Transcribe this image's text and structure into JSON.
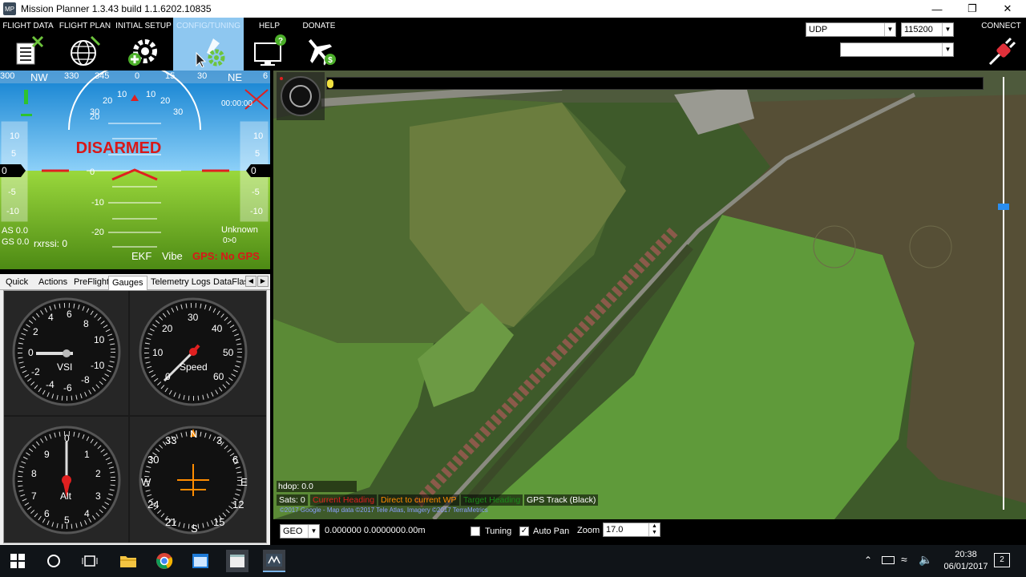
{
  "window": {
    "title": "Mission Planner 1.3.43 build 1.1.6202.10835",
    "app_icon_text": "MP"
  },
  "menu": {
    "flight_data": "FLIGHT DATA",
    "flight_plan": "FLIGHT PLAN",
    "initial_setup": "INITIAL SETUP",
    "config_tuning": "CONFIG/TUNING",
    "help": "HELP",
    "donate": "DONATE",
    "connect": "CONNECT"
  },
  "connection": {
    "port": "UDP",
    "baud": "115200",
    "profile": ""
  },
  "hud": {
    "status": "DISARMED",
    "compass_labels": [
      "300",
      "NW",
      "330",
      "345",
      "0",
      "15",
      "30",
      "NE",
      "6"
    ],
    "pitch_labels": [
      "20",
      "10",
      "0",
      "-10",
      "-20"
    ],
    "roll_labels": [
      "30",
      "20",
      "10",
      "10",
      "20",
      "30"
    ],
    "speed_ticks": [
      "10",
      "5",
      "0",
      "-5",
      "-10"
    ],
    "alt_ticks": [
      "10",
      "5",
      "0",
      "-5",
      "-10"
    ],
    "speed_value": "0",
    "alt_value": "0",
    "airspeed": "AS 0.0",
    "groundspeed": "GS 0.0",
    "rxrssi": "rxrssi: 0",
    "timer": "00:00:00",
    "mode": "Unknown",
    "distance": "0>0",
    "ekf": "EKF",
    "vibe": "Vibe",
    "gps": "GPS: No GPS"
  },
  "tabs": [
    "Quick",
    "Actions",
    "PreFlight",
    "Gauges",
    "Telemetry Logs",
    "DataFlas"
  ],
  "gauges": {
    "vsi": {
      "label": "VSI",
      "ticks": [
        "4",
        "6",
        "8",
        "10",
        "2",
        "0",
        "-2",
        "-4",
        "-6",
        "-8",
        "-10"
      ]
    },
    "speed": {
      "label": "Speed",
      "ticks": [
        "20",
        "30",
        "40",
        "10",
        "50",
        "0",
        "60"
      ]
    },
    "alt": {
      "label": "Alt",
      "ticks": [
        "0",
        "1",
        "2",
        "3",
        "4",
        "5",
        "6",
        "7",
        "8",
        "9"
      ]
    },
    "heading": {
      "ticks": [
        "N",
        "3",
        "6",
        "E",
        "12",
        "15",
        "S",
        "21",
        "24",
        "W",
        "30",
        "33"
      ]
    }
  },
  "map": {
    "hdop": "hdop: 0.0",
    "sats": "Sats: 0",
    "legend": {
      "current_heading": "Current Heading",
      "direct_wp": "Direct to current WP",
      "target_heading": "Target Heading",
      "gps_track": "GPS Track (Black)"
    },
    "copyright": "©2017 Google - Map data ©2017 Tele Atlas, Imagery ©2017 TerraMetrics",
    "colors": {
      "current_heading": "#e02020",
      "direct_wp": "#ff8c00",
      "target_heading": "#1a8a1a",
      "gps_track": "#ffffff"
    }
  },
  "bottom": {
    "coord_type": "GEO",
    "coords": "0.000000 0.000000",
    "alt": "0.00m",
    "tuning_label": "Tuning",
    "tuning_checked": false,
    "autopan_label": "Auto Pan",
    "autopan_checked": true,
    "zoom_label": "Zoom",
    "zoom_value": "17.0"
  },
  "taskbar": {
    "time": "20:38",
    "date": "06/01/2017",
    "notifications": "2"
  }
}
